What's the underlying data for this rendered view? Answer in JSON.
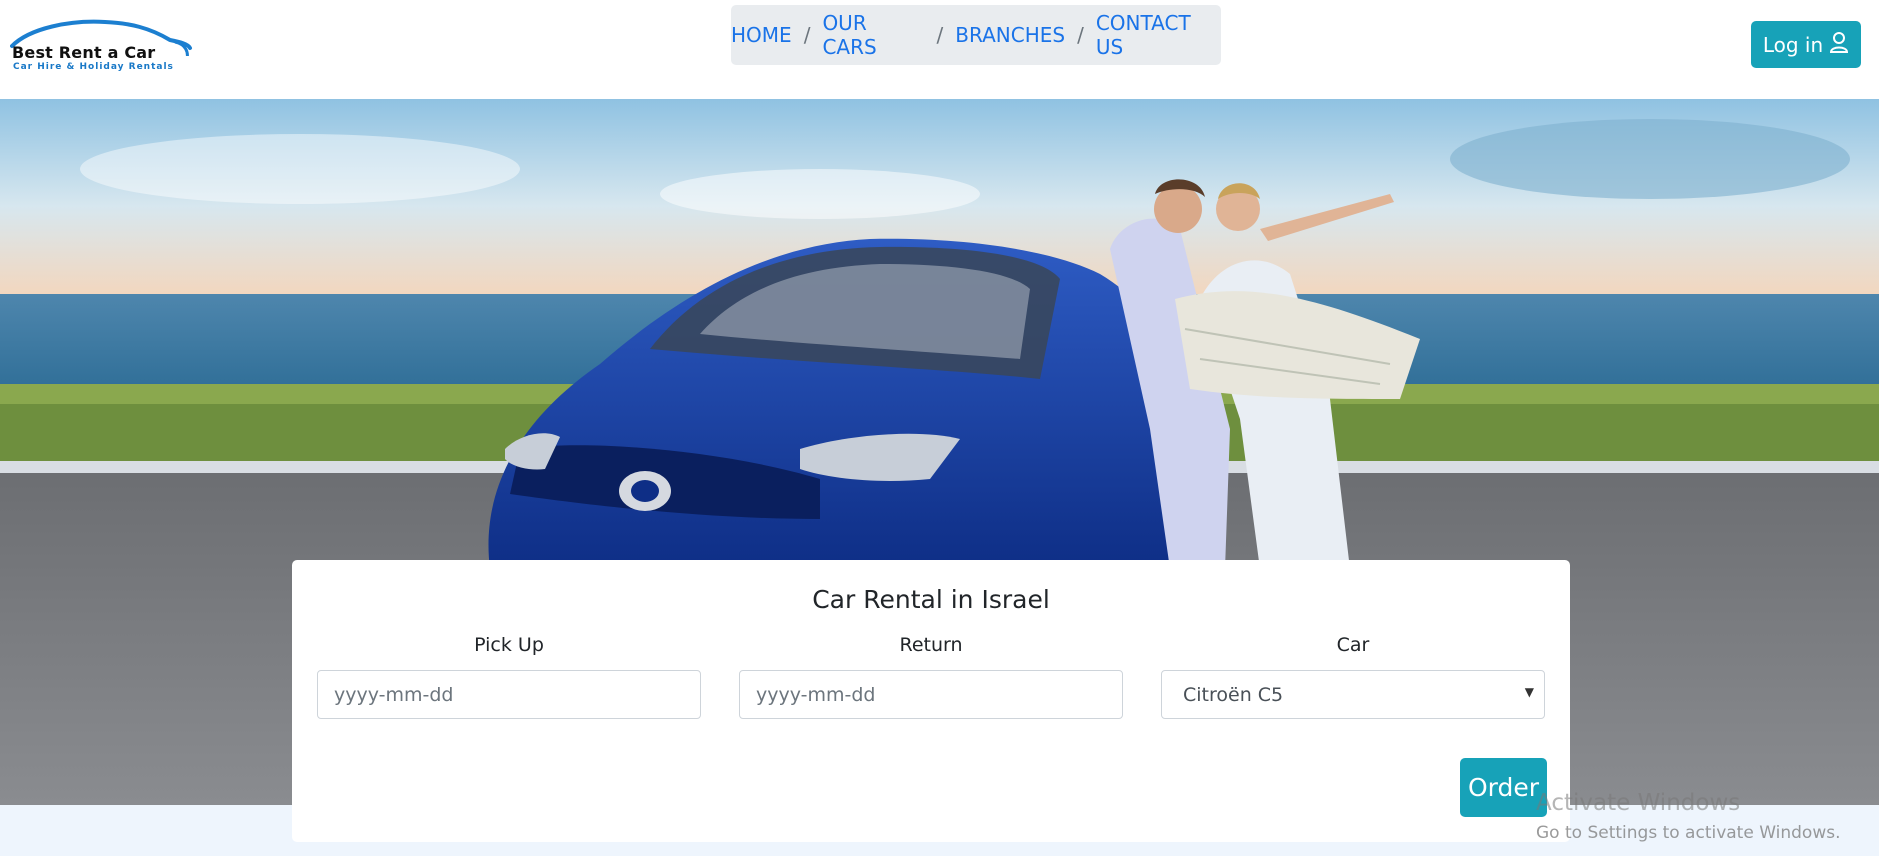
{
  "logo": {
    "title": "Best Rent a Car",
    "subtitle": "Car Hire & Holiday Rentals"
  },
  "nav": {
    "items": [
      {
        "label": "HOME"
      },
      {
        "label": "OUR CARS"
      },
      {
        "label": "BRANCHES"
      },
      {
        "label": "CONTACT US"
      }
    ],
    "separator": "/"
  },
  "header": {
    "login_label": "Log in"
  },
  "booking": {
    "title": "Car Rental in Israel",
    "pickup_label": "Pick Up",
    "pickup_placeholder": "yyyy-mm-dd",
    "return_label": "Return",
    "return_placeholder": "yyyy-mm-dd",
    "car_label": "Car",
    "car_selected": "Citroën C5",
    "order_label": "Order"
  },
  "system": {
    "watermark_title": "Activate Windows",
    "watermark_text": "Go to Settings to activate Windows."
  },
  "colors": {
    "accent": "#17a2b8",
    "link": "#1a73e8"
  }
}
